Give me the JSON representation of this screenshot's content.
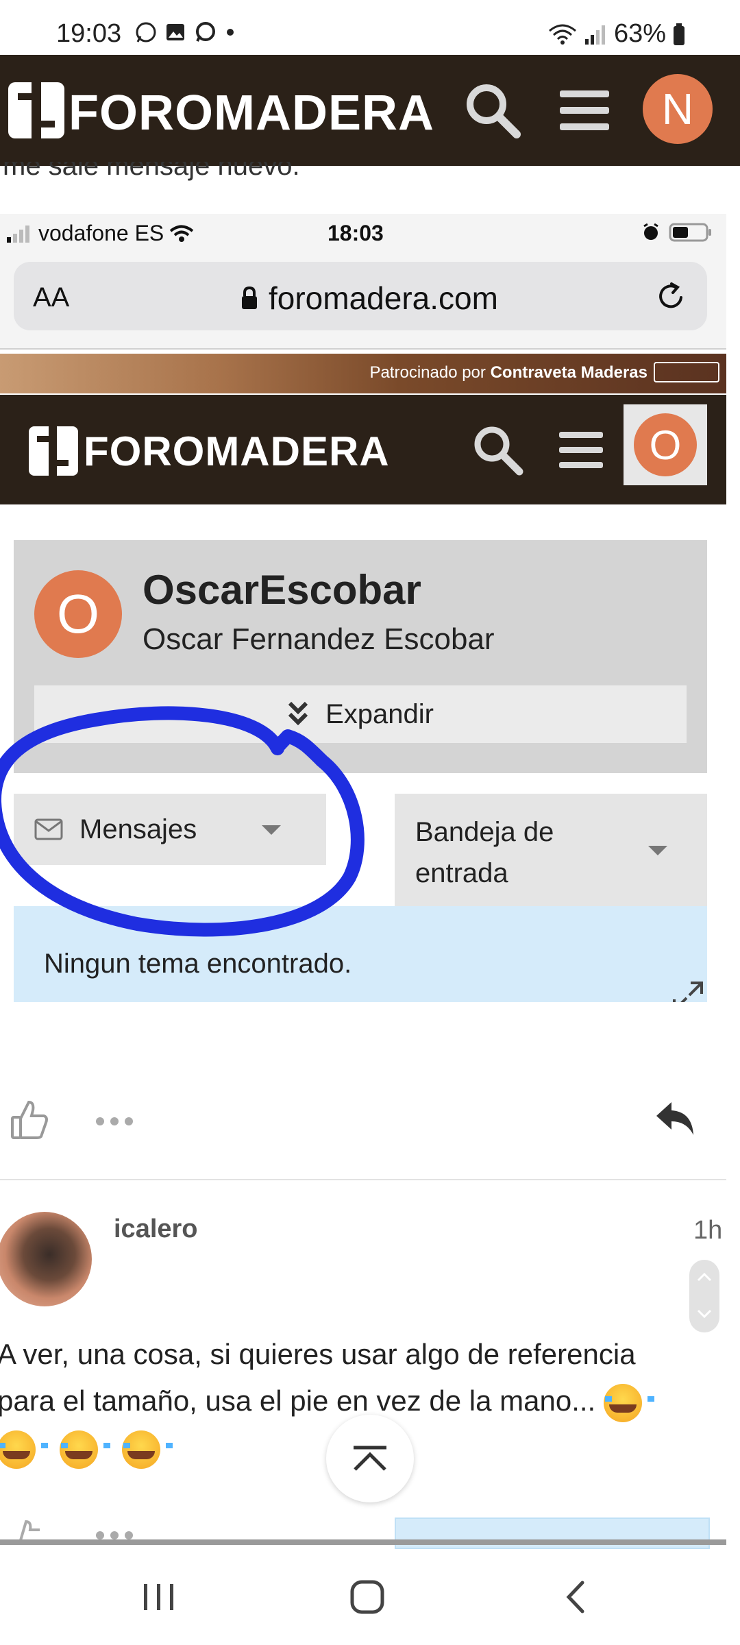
{
  "status_bar": {
    "time": "19:03",
    "battery": "63%"
  },
  "site": {
    "logo_text": "FOROMADERA",
    "user_initial": "N"
  },
  "previous_post_peek": "me sale mensaje nuevo.",
  "embedded_screenshot": {
    "ios_status": {
      "carrier": "vodafone ES",
      "time": "18:03"
    },
    "browser": {
      "text_size": "AA",
      "url": "foromadera.com"
    },
    "sponsor": {
      "prefix": "Patrocinado por",
      "name": "Contraveta Maderas"
    },
    "header": {
      "logo_text": "FOROMADERA",
      "user_initial": "O"
    },
    "profile": {
      "initial": "O",
      "username": "OscarEscobar",
      "full_name": "Oscar Fernandez Escobar",
      "expand_label": "Expandir"
    },
    "filters": {
      "messages_label": "Mensajes",
      "folder_label": "Bandeja de entrada"
    },
    "notice": "Ningun tema encontrado."
  },
  "post": {
    "username": "icalero",
    "time": "1h",
    "body_line1": "A ver, una cosa, si quieres usar algo de referencia",
    "body_line2": "para el tamaño, usa el pie en vez de la mano..."
  },
  "colors": {
    "header_bg": "#2b2118",
    "avatar": "#e07a4f",
    "notice_bg": "#d5ebfa",
    "annotation": "#1f2ee0"
  }
}
